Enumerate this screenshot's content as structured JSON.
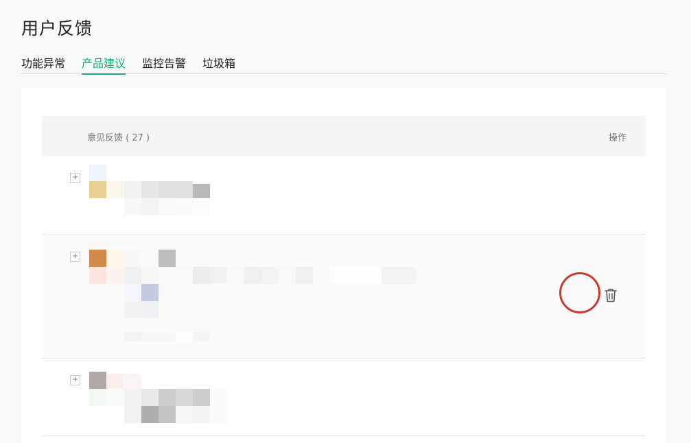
{
  "page": {
    "title": "用户反馈"
  },
  "tabs": [
    {
      "label": "功能异常",
      "active": false
    },
    {
      "label": "产品建议",
      "active": true
    },
    {
      "label": "监控告警",
      "active": false
    },
    {
      "label": "垃圾箱",
      "active": false
    }
  ],
  "table": {
    "header_left": "意见反馈 ( 27 )",
    "header_right": "操作"
  },
  "rows": [
    {
      "expand_symbol": "+"
    },
    {
      "expand_symbol": "+",
      "action_icon": "trash-icon"
    },
    {
      "expand_symbol": "+"
    }
  ],
  "colors": {
    "accent": "#1aad6b",
    "highlight_circle": "#c93a2c"
  }
}
